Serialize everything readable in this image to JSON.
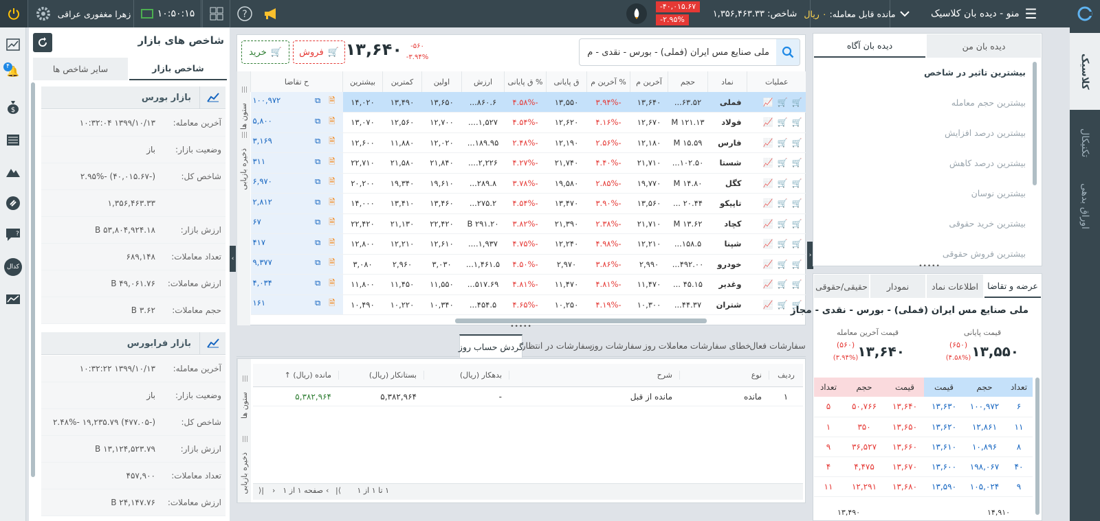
{
  "topbar": {
    "menu_title": "منو - دیده بان کلاسیک",
    "tradable_label": "مانده قابل معامله:",
    "tradable_value": "۰ ریال",
    "index_label": "شاخص:",
    "index_value": "۱,۳۵۶,۴۶۳.۳۳",
    "index_change": "-۴۰,۰۱۵.۶۷",
    "index_pct": "-۲.۹۵%",
    "clock": "۱۰:۵۰:۱۵",
    "user": "زهرا مغفوری عراقی"
  },
  "rail": {
    "tabs": [
      "کلاسیک",
      "تکنیکال",
      "اوراق بدهی"
    ]
  },
  "left_icons": {
    "badge": "۴",
    "kodal": "کدال"
  },
  "market": {
    "title": "شاخص های بازار",
    "tabs": [
      "شاخص بازار",
      "سایر شاخص ها"
    ],
    "bourse": {
      "title": "بازار بورس",
      "rows": [
        {
          "k": "آخرین معامله:",
          "v": "۱۳۹۹/۱۰/۱۳ ۱۰:۳۲:۰۴"
        },
        {
          "k": "وضعیت بازار:",
          "v": "باز"
        },
        {
          "k": "شاخص کل:",
          "v": "(-۴۰,۰۱۵.۶۷) -۲.۹۵%"
        },
        {
          "k": "",
          "v": "۱,۳۵۶,۴۶۳.۳۳"
        },
        {
          "k": "ارزش بازار:",
          "v": "۵۳,۸۰۴,۹۲۴.۱۸ B"
        },
        {
          "k": "تعداد معاملات:",
          "v": "۶۸۹,۱۴۸"
        },
        {
          "k": "ارزش معاملات:",
          "v": "۴۹,۰۶۱.۷۶ B"
        },
        {
          "k": "حجم معاملات:",
          "v": "۳.۶۲ B"
        }
      ]
    },
    "farabourse": {
      "title": "بازار فرابورس",
      "rows": [
        {
          "k": "آخرین معامله:",
          "v": "۱۳۹۹/۱۰/۱۳ ۱۰:۳۲:۲۲"
        },
        {
          "k": "وضعیت بازار:",
          "v": "باز"
        },
        {
          "k": "شاخص کل:",
          "v": "(-۴۷۷.۰۵) ۱۹,۲۳۵.۷۹ -۲.۴۸%"
        },
        {
          "k": "ارزش بازار:",
          "v": "۱۳,۱۲۴,۵۲۳.۷۹ B"
        },
        {
          "k": "تعداد معاملات:",
          "v": "۴۵۷,۹۰۰"
        },
        {
          "k": "ارزش معاملات:",
          "v": "۲۴,۱۴۷.۷۶ B"
        }
      ]
    }
  },
  "order_bar": {
    "search_value": "ملی صنایع مس ایران (فملی) - بورس - نقدی - م",
    "price": "۱۳,۶۴۰",
    "change": "-۵۶۰",
    "change_pct": "-۳.۹۴%",
    "sell": "فروش",
    "buy": "خرید"
  },
  "watch": {
    "side_labels": [
      "ستون ها",
      "ذخیره بازیابی"
    ],
    "headers": [
      "عملیات",
      "نماد",
      "حجم",
      "آخرین م",
      "% آخرین م",
      "ق پایانی",
      "% ق پایانی",
      "ارزش",
      "اولین",
      "کمترین",
      "بیشترین",
      "ح تقاضا"
    ],
    "rows": [
      [
        "فملی",
        "۶۳.۵۲...",
        "۱۳,۶۴۰",
        "-۳.۹۴%",
        "۱۳,۵۵۰",
        "-۴.۵۸%",
        "۸۶۰.۶...",
        "۱۳,۶۵۰",
        "۱۳,۴۹۰",
        "۱۴,۰۲۰",
        "۱۰۰,۹۷۲"
      ],
      [
        "فولاد",
        "۱۲۱.۱۳ M",
        "۱۲,۶۷۰",
        "-۴.۱۶%",
        "۱۲,۶۲۰",
        "-۴.۵۴%",
        "۱,۵۲۷....",
        "۱۲,۷۰۰",
        "۱۲,۵۶۰",
        "۱۳,۰۷۰",
        "۵,۸۰۰"
      ],
      [
        "فارس",
        "۱۵.۵۹ M",
        "۱۲,۱۸۰",
        "-۲.۵۶%",
        "۱۲,۱۹۰",
        "-۲.۴۸%",
        "۱۸۹.۹۵...",
        "۱۲,۰۲۰",
        "۱۱,۸۸۰",
        "۱۲,۶۰۰",
        "۳,۱۶۹"
      ],
      [
        "شستا",
        "۱۰۲.۵۰...",
        "۲۱,۷۱۰",
        "-۴.۴۰%",
        "۲۱,۷۴۰",
        "-۴.۲۷%",
        "۲,۲۲۶....",
        "۲۱,۸۴۰",
        "۲۱,۵۸۰",
        "۲۲,۷۱۰",
        "۳۱۱"
      ],
      [
        "کگل",
        "۱۴.۸۰ M",
        "۱۹,۷۷۰",
        "-۲.۸۵%",
        "۱۹,۵۸۰",
        "-۳.۷۸%",
        "۲۸۹.۸...",
        "۱۹,۶۱۰",
        "۱۹,۳۴۰",
        "۲۰,۲۰۰",
        "۶,۹۷۰"
      ],
      [
        "تاپیکو",
        "۲۰.۴۴ ...",
        "۱۳,۵۶۰",
        "-۳.۹۰%",
        "۱۳,۴۷۰",
        "-۴.۵۴%",
        "۲۷۵.۲...",
        "۱۳,۴۶۰",
        "۱۳,۴۱۰",
        "۱۴,۰۰۰",
        "۲,۸۱۲"
      ],
      [
        "کچاد",
        "۱۳.۶۲ M",
        "۲۱,۷۱۰",
        "-۲.۳۸%",
        "۲۱,۳۹۰",
        "-۳.۸۲%",
        "۲۹۱.۲۰ B",
        "۲۲,۴۲۰",
        "۲۱,۱۳۰",
        "۲۲,۴۲۰",
        "۶۷"
      ],
      [
        "شپنا",
        "۱۵۸.۵...",
        "۱۲,۲۱۰",
        "-۴.۹۸%",
        "۱۲,۲۴۰",
        "-۴.۷۵%",
        "۱,۹۳۷....",
        "۱۲,۶۱۰",
        "۱۲,۲۱۰",
        "۱۲,۸۰۰",
        "۴۱۷"
      ],
      [
        "خودرو",
        "۴۹۲.۰۰...",
        "۲,۹۹۰",
        "-۳.۸۶%",
        "۲,۹۷۰",
        "-۴.۵۰%",
        "۱,۴۶۱.۵...",
        "۳,۰۳۰",
        "۲,۹۶۰",
        "۳,۰۸۰",
        "۹,۳۷۷"
      ],
      [
        "وغدیر",
        "۴۵.۱۵ ...",
        "۱۱,۴۷۰",
        "-۴.۸۱%",
        "۱۱,۴۷۰",
        "-۴.۸۱%",
        "۵۱۷.۶۹...",
        "۱۱,۵۵۰",
        "۱۱,۴۵۰",
        "۱۱,۸۰۰",
        "۴,۰۳۴"
      ],
      [
        "شتران",
        "۴۴.۳۷...",
        "۱۰,۳۰۰",
        "-۴.۱۹%",
        "۱۰,۲۵۰",
        "-۴.۶۵%",
        "۴۵۴.۵...",
        "۱۰,۳۴۰",
        "۱۰,۲۲۰",
        "۱۰,۴۹۰",
        "۱۶۱"
      ]
    ]
  },
  "bottom": {
    "tabs": [
      "سفارشات فعال",
      "خطای سفارشات",
      "معاملات روز",
      "سفارشات روز",
      "سفارشات در انتظار",
      "گردش حساب روز"
    ],
    "headers": [
      "ردیف",
      "نوع",
      "شرح",
      "بدهکار (ریال)",
      "بستانکار (ریال)",
      "مانده (ریال)"
    ],
    "row": {
      "n": "۱",
      "type": "مانده",
      "desc": "مانده از قبل",
      "debit": "-",
      "credit": "۵,۳۸۲,۹۶۴",
      "balance": "۵,۳۸۲,۹۶۴"
    },
    "side_labels": [
      "ستون ها",
      "ذخیره بازیابی"
    ],
    "pager": {
      "page": "صفحه ۱ از ۱",
      "count": "۱ تا ۱ از ۱"
    }
  },
  "watchlists": {
    "tabs": [
      "دیده بان من",
      "دیده بان آگاه"
    ],
    "items": [
      "بیشترین تاثیر در شاخص",
      "بیشترین حجم معامله",
      "بیشترین درصد افزایش",
      "بیشترین درصد کاهش",
      "بیشترین نوسان",
      "بیشترین خرید حقوقی",
      "بیشترین فروش حقوقی"
    ]
  },
  "orderbook": {
    "tabs": [
      "عرضه و تقاضا",
      "اطلاعات نماد",
      "نمودار",
      "حقیقی/حقوقی"
    ],
    "title": "ملی صنایع مس ایران (فملی) - بورس - نقدی - مجاز",
    "last_label": "قیمت آخرین معامله",
    "last_value": "۱۳,۶۴۰",
    "last_change": "(۵۶۰)",
    "last_pct": "(۳.۹۴%)",
    "close_label": "قیمت پایانی",
    "close_value": "۱۳,۵۵۰",
    "close_change": "(۶۵۰)",
    "close_pct": "(۴.۵۸%)",
    "headers": [
      "تعداد",
      "حجم",
      "قیمت",
      "قیمت",
      "حجم",
      "تعداد"
    ],
    "rows": [
      [
        "۶",
        "۱۰۰,۹۷۲",
        "۱۳,۶۳۰",
        "۱۳,۶۴۰",
        "۵۰,۷۶۶",
        "۵"
      ],
      [
        "۱۱",
        "۱۲,۸۶۱",
        "۱۳,۶۲۰",
        "۱۳,۶۵۰",
        "۳۵۰",
        "۱"
      ],
      [
        "۸",
        "۱۰,۸۹۶",
        "۱۳,۶۱۰",
        "۱۳,۶۶۰",
        "۳۶,۵۲۷",
        "۹"
      ],
      [
        "۴۰",
        "۱۹۸,۰۶۷",
        "۱۳,۶۰۰",
        "۱۳,۶۷۰",
        "۴,۴۷۵",
        "۴"
      ],
      [
        "۹",
        "۱۰۵,۰۲۴",
        "۱۳,۵۹۰",
        "۱۳,۶۸۰",
        "۱۲,۲۹۱",
        "۱۱"
      ]
    ],
    "footer_right": "۱۴,۹۱۰",
    "footer_left": "۱۳,۴۹۰"
  },
  "colors": {
    "topbar": "#37474f",
    "accent": "#1e88e5",
    "buy": "#2e7d32",
    "sell": "#e53935"
  }
}
